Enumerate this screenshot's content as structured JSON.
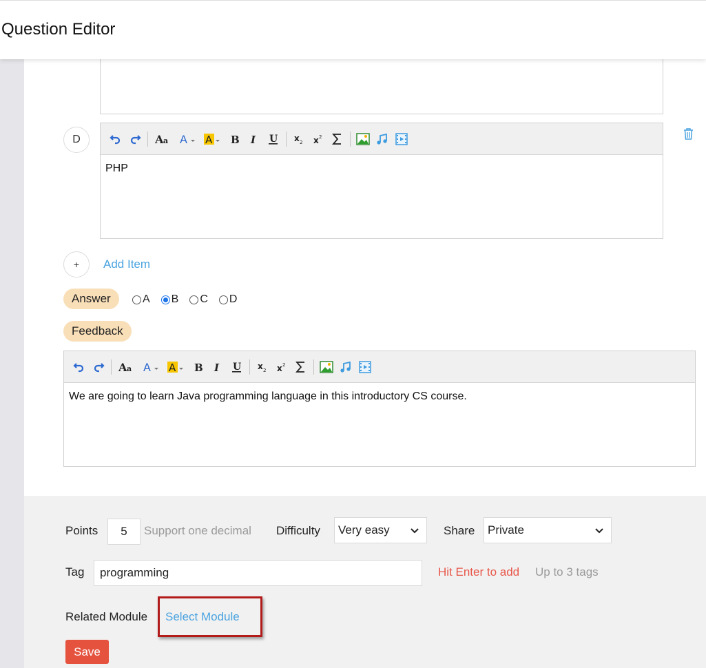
{
  "header": {
    "title": "Question Editor"
  },
  "option_d": {
    "letter": "D",
    "content": "PHP"
  },
  "add_item": {
    "icon": "+",
    "label": "Add Item"
  },
  "answer": {
    "label": "Answer",
    "options": [
      {
        "label": "A",
        "checked": false
      },
      {
        "label": "B",
        "checked": true
      },
      {
        "label": "C",
        "checked": false
      },
      {
        "label": "D",
        "checked": false
      }
    ]
  },
  "feedback": {
    "label": "Feedback",
    "content": "We are going to learn Java programming language in this introductory CS course."
  },
  "toolbar_icons": [
    "undo-icon",
    "redo-icon",
    "font-size-icon",
    "font-color-icon",
    "highlight-color-icon",
    "bold-icon",
    "italic-icon",
    "underline-icon",
    "subscript-icon",
    "superscript-icon",
    "formula-icon",
    "image-icon",
    "audio-icon",
    "video-icon"
  ],
  "settings": {
    "points_label": "Points",
    "points_value": "5",
    "points_hint": "Support one decimal",
    "difficulty_label": "Difficulty",
    "difficulty_value": "Very easy",
    "share_label": "Share",
    "share_value": "Private",
    "tag_label": "Tag",
    "tag_value": "programming",
    "tag_hint_red": "Hit Enter to add",
    "tag_hint_gray": "Up to 3 tags",
    "related_module_label": "Related Module",
    "select_module_link": "Select Module",
    "save_label": "Save"
  },
  "colors": {
    "accent_blue": "#4aa3df",
    "save_red": "#e5533f",
    "pill_bg": "#f9dfb8",
    "highlight_box": "#b31b1b"
  }
}
